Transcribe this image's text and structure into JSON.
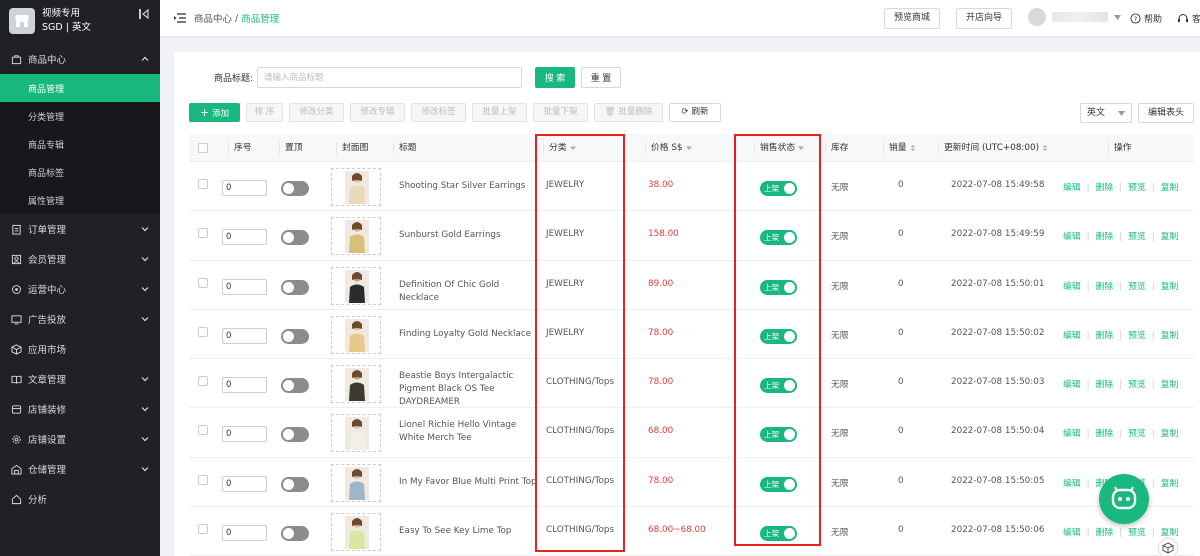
{
  "sidebar": {
    "brand_name": "视频专用",
    "brand_sub": "SGD | 英文",
    "groups": [
      {
        "label": "商品中心",
        "icon": "bag-icon"
      },
      {
        "label": "订单管理",
        "icon": "clipboard-icon"
      },
      {
        "label": "会员管理",
        "icon": "user-icon"
      },
      {
        "label": "运营中心",
        "icon": "target-icon"
      },
      {
        "label": "广告投放",
        "icon": "monitor-icon"
      },
      {
        "label": "应用市场",
        "icon": "box-icon"
      },
      {
        "label": "文章管理",
        "icon": "book-icon"
      },
      {
        "label": "店铺装修",
        "icon": "brush-icon"
      },
      {
        "label": "店铺设置",
        "icon": "gear-icon"
      },
      {
        "label": "仓储管理",
        "icon": "warehouse-icon"
      },
      {
        "label": "分析",
        "icon": "home-icon"
      }
    ],
    "sub_items": [
      "商品管理",
      "分类管理",
      "商品专辑",
      "商品标签",
      "属性管理"
    ]
  },
  "topbar": {
    "crumb_parent": "商品中心",
    "crumb_sep": "/",
    "crumb_current": "商品管理",
    "preview_btn": "预览商城",
    "guide_btn": "开店向导",
    "help": "帮助",
    "support": "客"
  },
  "search": {
    "label": "商品标题:",
    "placeholder": "请输入商品标题",
    "search_btn": "搜 索",
    "reset_btn": "重 置"
  },
  "toolbar": {
    "add": "添加",
    "sort": "排 序",
    "edit_category": "修改分类",
    "edit_album": "修改专辑",
    "edit_tag": "修改标签",
    "batch_on": "批量上架",
    "batch_off": "批量下架",
    "batch_delete": "批量删除",
    "refresh": "刷新",
    "lang": "英文",
    "edit_header": "编辑表头"
  },
  "table": {
    "headers": {
      "index": "序号",
      "pin": "置顶",
      "cover": "封面图",
      "title": "标题",
      "category": "分类",
      "price": "价格 S$",
      "status": "销售状态",
      "stock": "库存",
      "sales": "销量",
      "updated": "更新时间 (UTC+08:00)",
      "actions": "操作"
    },
    "ops": {
      "edit": "编辑",
      "delete": "删除",
      "preview": "预览",
      "copy": "复制"
    },
    "status_on": "上架",
    "rows": [
      {
        "order": "0",
        "title": "Shooting Star Silver Earrings",
        "category": "JEWELRY",
        "price": "38.00",
        "stock": "无限",
        "sales": "0",
        "updated": "2022-07-08 15:49:58"
      },
      {
        "order": "0",
        "title": "Sunburst Gold Earrings",
        "category": "JEWELRY",
        "price": "158.00",
        "stock": "无限",
        "sales": "0",
        "updated": "2022-07-08 15:49:59"
      },
      {
        "order": "0",
        "title": "Definition Of Chic Gold Necklace",
        "category": "JEWELRY",
        "price": "89.00",
        "stock": "无限",
        "sales": "0",
        "updated": "2022-07-08 15:50:01"
      },
      {
        "order": "0",
        "title": "Finding Loyalty Gold Necklace",
        "category": "JEWELRY",
        "price": "78.00",
        "stock": "无限",
        "sales": "0",
        "updated": "2022-07-08 15:50:02"
      },
      {
        "order": "0",
        "title": "Beastie Boys Intergalactic Pigment Black OS Tee DAYDREAMER",
        "category": "CLOTHING/Tops",
        "price": "78.00",
        "stock": "无限",
        "sales": "0",
        "updated": "2022-07-08 15:50:03"
      },
      {
        "order": "0",
        "title": "Lionel Richie Hello Vintage White Merch Tee",
        "category": "CLOTHING/Tops",
        "price": "68.00",
        "stock": "无限",
        "sales": "0",
        "updated": "2022-07-08 15:50:04"
      },
      {
        "order": "0",
        "title": "In My Favor Blue Multi Print Top",
        "category": "CLOTHING/Tops",
        "price": "78.00",
        "stock": "无限",
        "sales": "0",
        "updated": "2022-07-08 15:50:05"
      },
      {
        "order": "0",
        "title": "Easy To See Key Lime Top",
        "category": "CLOTHING/Tops",
        "price": "68.00~68.00",
        "stock": "无限",
        "sales": "0",
        "updated": "2022-07-08 15:50:06"
      }
    ]
  },
  "colors": {
    "accent": "#19b87f",
    "price": "#e83a3a",
    "highlight": "#e8211d",
    "sidebar": "#1f2126"
  }
}
